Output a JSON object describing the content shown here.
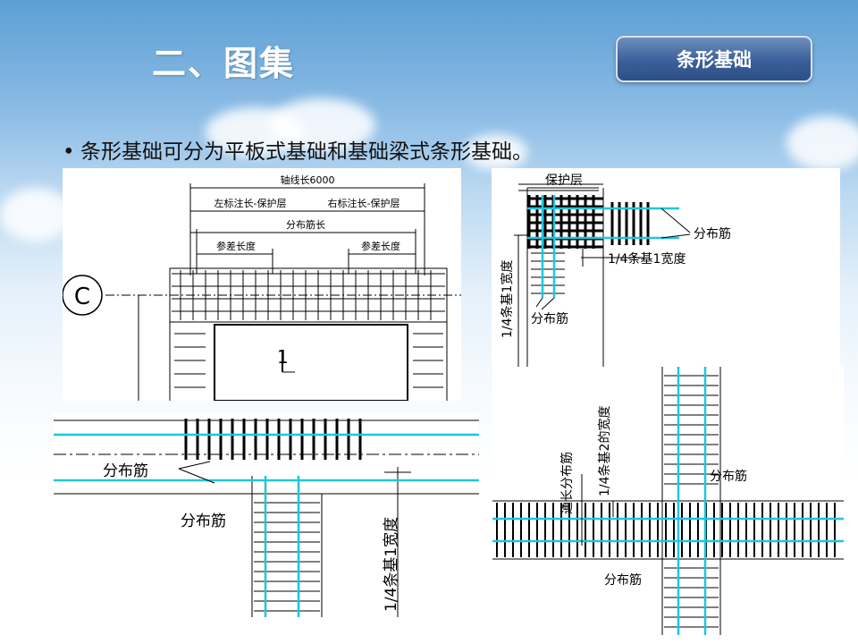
{
  "slide": {
    "title": "二、图集",
    "badge": "条形基础",
    "bullet": "条形基础可分为平板式基础和基础梁式条形基础。"
  },
  "figure1": {
    "label_axis_length": "轴线长6000",
    "label_left": "左标注长-保护层",
    "label_right": "右标注长-保护层",
    "label_distribution_length": "分布筋长",
    "label_overlap_left": "参差长度",
    "label_overlap_right": "参差长度",
    "label_axis": "C",
    "label_section": "1"
  },
  "figure2": {
    "label_cover": "保护层",
    "label_distribution_right": "分布筋",
    "label_quarter_width": "1/4条基1宽度",
    "label_quarter_width_vertical": "1/4条基1宽度",
    "label_distribution_bottom": "分布筋"
  },
  "figure3": {
    "label_distribution_left": "分布筋",
    "label_distribution_mid": "分布筋",
    "label_quarter_width": "1/4条基1宽度"
  },
  "figure4": {
    "label_through": "通长分布筋",
    "label_quarter_width2": "1/4条基2的宽度",
    "label_distribution_right": "分布筋",
    "label_distribution_bottom": "分布筋"
  },
  "colors": {
    "rebar": "#000000",
    "distribution": "#1fc6de",
    "badge": "#3a5f99"
  }
}
